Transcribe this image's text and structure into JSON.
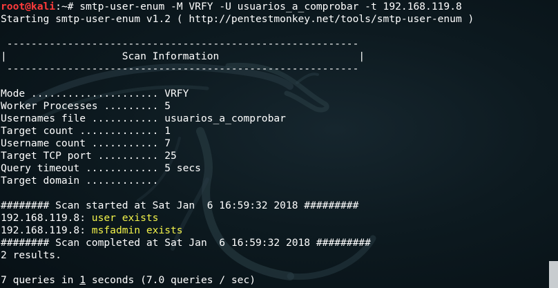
{
  "prompt": {
    "user_host": "root@kali",
    "path_symbol": ":~# ",
    "command": "smtp-user-enum -M VRFY -U usuarios_a_comprobar -t 192.168.119.8"
  },
  "output": {
    "starting": "Starting smtp-user-enum v1.2 ( http://pentestmonkey.net/tools/smtp-user-enum )",
    "blank1": "",
    "rule_top": " ----------------------------------------------------------",
    "scan_info_title": "|                   Scan Information                       |",
    "rule_bottom": " ----------------------------------------------------------",
    "blank2": "",
    "mode": "Mode ..................... VRFY",
    "worker_processes": "Worker Processes ......... 5",
    "usernames_file": "Usernames file ........... usuarios_a_comprobar",
    "target_count": "Target count ............. 1",
    "username_count": "Username count ........... 7",
    "target_tcp_port": "Target TCP port .......... 25",
    "query_timeout": "Query timeout ............ 5 secs",
    "target_domain": "Target domain ............",
    "blank3": "",
    "scan_started": "######## Scan started at Sat Jan  6 16:59:32 2018 #########",
    "result1_host": "192.168.119.8: ",
    "result1_text": "user exists",
    "result2_host": "192.168.119.8: ",
    "result2_text": "msfadmin exists",
    "scan_completed": "######## Scan completed at Sat Jan  6 16:59:32 2018 #########",
    "results_count": "2 results.",
    "blank4": "",
    "queries_prefix": "7 queries in ",
    "queries_cursor": "1",
    "queries_suffix": " seconds (7.0 queries / sec)"
  },
  "colors": {
    "background": "#0d1a20",
    "prompt_user": "#ff3b3b",
    "highlight_yellow": "#f2f24a",
    "text": "#ffffff"
  },
  "icons": {
    "background_logo": "kali-dragon-icon"
  }
}
